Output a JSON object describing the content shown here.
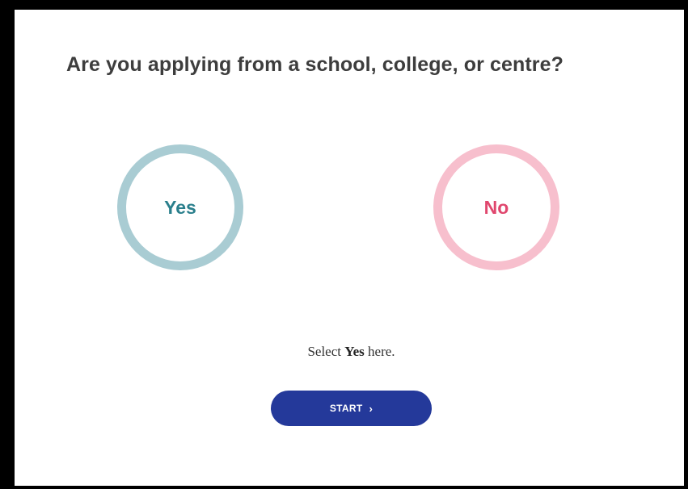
{
  "question": {
    "title": "Are you applying from a school, college, or centre?"
  },
  "choices": [
    {
      "label": "Yes",
      "ring_color": "#a9ccd3",
      "text_color": "#2a7f8c"
    },
    {
      "label": "No",
      "ring_color": "#f7bfcd",
      "text_color": "#e0476e"
    }
  ],
  "hint": {
    "prefix": "Select ",
    "emphasis": "Yes",
    "suffix": " here."
  },
  "start_button": {
    "label": "START",
    "icon": "chevron-right-icon",
    "chevron": "›",
    "color": "#24399a"
  }
}
